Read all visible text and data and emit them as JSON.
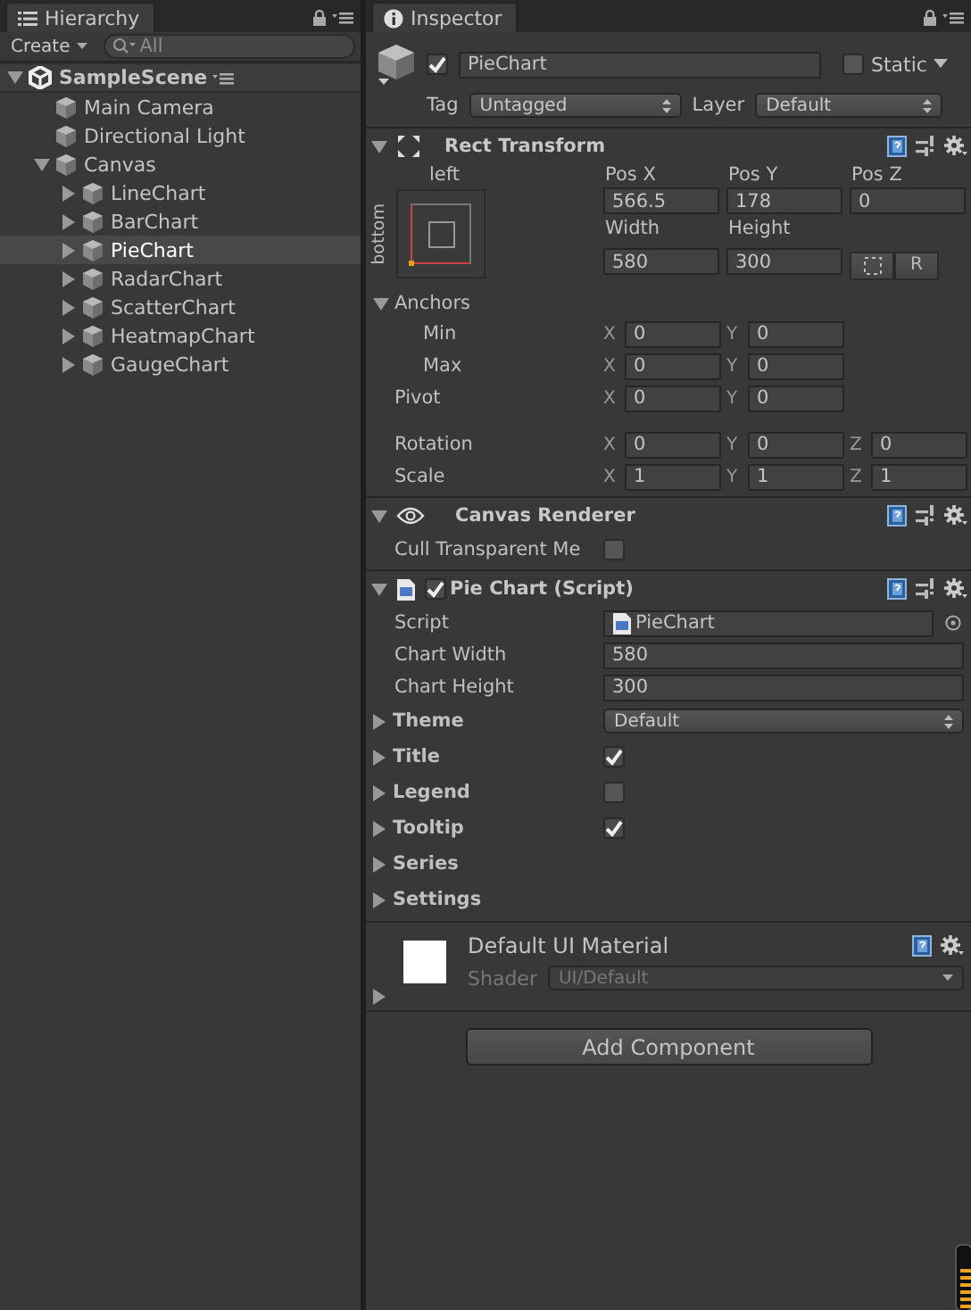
{
  "hierarchy": {
    "tab": "Hierarchy",
    "create": "Create",
    "search_placeholder": "All",
    "tree": [
      {
        "label": "SampleScene",
        "kind": "scene",
        "expanded": true,
        "selected": false,
        "children": [
          {
            "label": "Main Camera",
            "kind": "object",
            "selected": false
          },
          {
            "label": "Directional Light",
            "kind": "object",
            "selected": false
          },
          {
            "label": "Canvas",
            "kind": "object",
            "expanded": true,
            "selected": false,
            "children": [
              {
                "label": "LineChart",
                "kind": "object",
                "expanded": false,
                "selected": false
              },
              {
                "label": "BarChart",
                "kind": "object",
                "expanded": false,
                "selected": false
              },
              {
                "label": "PieChart",
                "kind": "object",
                "expanded": false,
                "selected": true
              },
              {
                "label": "RadarChart",
                "kind": "object",
                "expanded": false,
                "selected": false
              },
              {
                "label": "ScatterChart",
                "kind": "object",
                "expanded": false,
                "selected": false
              },
              {
                "label": "HeatmapChart",
                "kind": "object",
                "expanded": false,
                "selected": false
              },
              {
                "label": "GaugeChart",
                "kind": "object",
                "expanded": false,
                "selected": false
              }
            ]
          }
        ]
      }
    ]
  },
  "inspector": {
    "tab": "Inspector",
    "object": {
      "active": true,
      "name": "PieChart",
      "static": false,
      "static_label": "Static",
      "tag_label": "Tag",
      "tag": "Untagged",
      "layer_label": "Layer",
      "layer": "Default"
    },
    "components": [
      {
        "kind": "rect_transform",
        "title": "Rect Transform",
        "expanded": true,
        "anchor_h": "left",
        "anchor_v": "bottom",
        "pos": [
          {
            "label": "Pos X",
            "value": "566.5"
          },
          {
            "label": "Pos Y",
            "value": "178"
          },
          {
            "label": "Pos Z",
            "value": "0"
          }
        ],
        "size": [
          {
            "label": "Width",
            "value": "580"
          },
          {
            "label": "Height",
            "value": "300"
          }
        ],
        "raw_button": "R",
        "rows": [
          {
            "label": "Anchors",
            "expanded": true,
            "children": [
              {
                "label": "Min",
                "fields": [
                  {
                    "axis": "X",
                    "value": "0"
                  },
                  {
                    "axis": "Y",
                    "value": "0"
                  }
                ]
              },
              {
                "label": "Max",
                "fields": [
                  {
                    "axis": "X",
                    "value": "0"
                  },
                  {
                    "axis": "Y",
                    "value": "0"
                  }
                ]
              }
            ]
          },
          {
            "label": "Pivot",
            "fields": [
              {
                "axis": "X",
                "value": "0"
              },
              {
                "axis": "Y",
                "value": "0"
              }
            ]
          },
          {
            "label": "Rotation",
            "gap": true,
            "fields": [
              {
                "axis": "X",
                "value": "0"
              },
              {
                "axis": "Y",
                "value": "0"
              },
              {
                "axis": "Z",
                "value": "0"
              }
            ]
          },
          {
            "label": "Scale",
            "fields": [
              {
                "axis": "X",
                "value": "1"
              },
              {
                "axis": "Y",
                "value": "1"
              },
              {
                "axis": "Z",
                "value": "1"
              }
            ]
          }
        ]
      },
      {
        "kind": "canvas_renderer",
        "title": "Canvas Renderer",
        "expanded": true,
        "props": [
          {
            "kind": "checkbox",
            "label": "Cull Transparent Me",
            "checked": false
          }
        ]
      },
      {
        "kind": "script",
        "title": "Pie Chart (Script)",
        "enabled": true,
        "expanded": true,
        "props": [
          {
            "kind": "object",
            "label": "Script",
            "value": "PieChart"
          },
          {
            "kind": "text",
            "label": "Chart Width",
            "value": "580"
          },
          {
            "kind": "text",
            "label": "Chart Height",
            "value": "300"
          },
          {
            "kind": "dropdown",
            "label": "Theme",
            "value": "Default",
            "expanded": false
          },
          {
            "kind": "checkbox",
            "label": "Title",
            "checked": true,
            "expanded": false
          },
          {
            "kind": "checkbox",
            "label": "Legend",
            "checked": false,
            "expanded": false
          },
          {
            "kind": "checkbox",
            "label": "Tooltip",
            "checked": true,
            "expanded": false
          },
          {
            "kind": "foldout",
            "label": "Series",
            "expanded": false
          },
          {
            "kind": "foldout",
            "label": "Settings",
            "expanded": false
          }
        ]
      },
      {
        "kind": "material",
        "title": "Default UI Material",
        "expanded": false,
        "shader_label": "Shader",
        "shader": "UI/Default"
      }
    ],
    "add_component": "Add Component"
  }
}
